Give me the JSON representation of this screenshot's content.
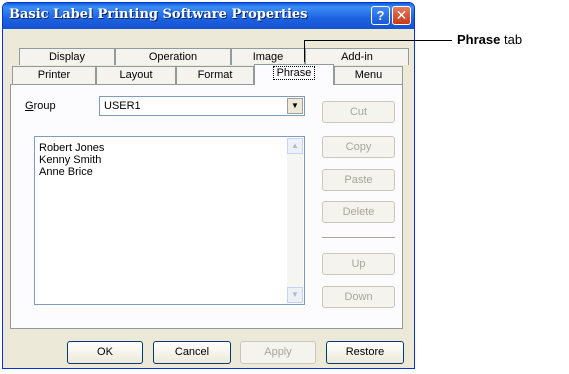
{
  "window": {
    "title": "Basic Label Printing Software Properties",
    "help_glyph": "?",
    "close_glyph": "✕"
  },
  "tabs": {
    "row1": [
      "Display",
      "Operation",
      "Image",
      "Add-in"
    ],
    "row2": [
      "Printer",
      "Layout",
      "Format",
      "Phrase",
      "Menu"
    ],
    "active": "Phrase"
  },
  "group": {
    "label_prefix": "",
    "label_accel": "G",
    "label_rest": "roup",
    "selected": "USER1"
  },
  "phrases": [
    "Robert Jones",
    "Kenny Smith",
    "Anne Brice"
  ],
  "side_buttons": {
    "cut": {
      "accel": "t",
      "text": "Cut"
    },
    "copy": {
      "text": "Copy"
    },
    "paste": {
      "text": "Paste"
    },
    "delete": {
      "text": "Delete"
    },
    "up": {
      "text": "Up"
    },
    "down": {
      "text": "Down"
    }
  },
  "footer": {
    "ok": "OK",
    "cancel": "Cancel",
    "apply": "Apply",
    "restore": "Restore"
  },
  "callout": {
    "bold": "Phrase",
    "rest": " tab"
  },
  "colors": {
    "title_bar": "#1d62e0",
    "dialog_bg": "#ece9d8",
    "disabled_text": "#a7a69b"
  }
}
